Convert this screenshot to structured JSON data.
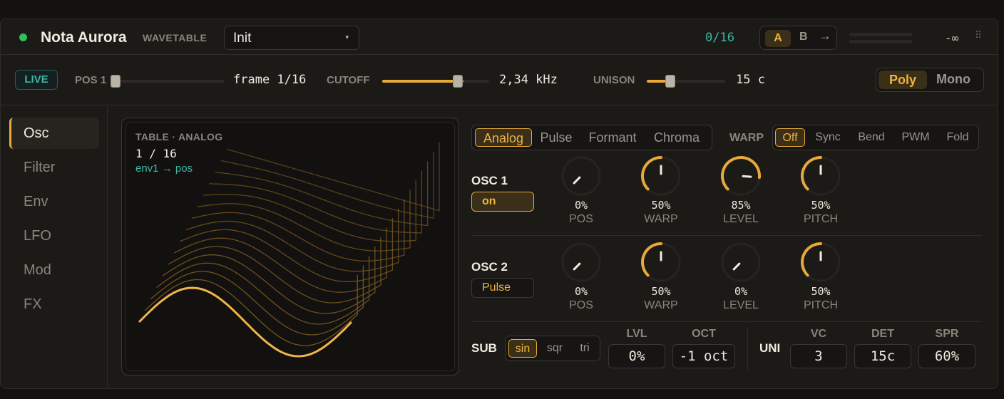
{
  "header": {
    "status_dot_color": "#2fbf5c",
    "plugin_name": "Nota Aurora",
    "engine_type": "WAVETABLE",
    "preset_name": "Init",
    "preset_arrow": "▾",
    "preset_count": "0/16",
    "ab": {
      "a": "A",
      "b": "B",
      "copy": "→"
    },
    "level_readout": "-∞",
    "drag_grip": "⠿"
  },
  "macros": {
    "live_badge": "LIVE",
    "pos": {
      "label": "POS 1",
      "value": "frame 1/16",
      "level": 0.0
    },
    "cutoff": {
      "label": "CUTOFF",
      "value": "2,34 kHz",
      "level": 0.76
    },
    "unison": {
      "label": "UNISON",
      "value": "15 c",
      "level": 0.3
    },
    "voice_mode": {
      "poly": "Poly",
      "mono": "Mono",
      "selected": "Poly"
    }
  },
  "sidebar": {
    "items": [
      {
        "label": "Osc",
        "active": true
      },
      {
        "label": "Filter",
        "active": false
      },
      {
        "label": "Env",
        "active": false
      },
      {
        "label": "LFO",
        "active": false
      },
      {
        "label": "Mod",
        "active": false
      },
      {
        "label": "FX",
        "active": false
      }
    ]
  },
  "wavetable": {
    "title": "TABLE · ANALOG",
    "frame": "1 / 16",
    "modulation": "env1 → pos",
    "accent_color": "#e8a93a"
  },
  "table_types": {
    "options": [
      "Analog",
      "Pulse",
      "Formant",
      "Chroma"
    ],
    "selected": "Analog"
  },
  "warp": {
    "label": "WARP",
    "options": [
      "Off",
      "Sync",
      "Bend",
      "PWM",
      "Fold"
    ],
    "selected": "Off"
  },
  "osc1": {
    "label": "OSC 1",
    "toggle": "on",
    "knobs": [
      {
        "name": "POS",
        "value": "0%",
        "level": 0.0
      },
      {
        "name": "WARP",
        "value": "50%",
        "level": 0.5
      },
      {
        "name": "LEVEL",
        "value": "85%",
        "level": 0.85
      },
      {
        "name": "PITCH",
        "value": "50%",
        "level": 0.5
      }
    ]
  },
  "osc2": {
    "label": "OSC 2",
    "toggle": "Pulse",
    "knobs": [
      {
        "name": "POS",
        "value": "0%",
        "level": 0.0
      },
      {
        "name": "WARP",
        "value": "50%",
        "level": 0.5
      },
      {
        "name": "LEVEL",
        "value": "0%",
        "level": 0.0
      },
      {
        "name": "PITCH",
        "value": "50%",
        "level": 0.5
      }
    ]
  },
  "sub": {
    "label": "SUB",
    "shapes": [
      "sin",
      "sqr",
      "tri"
    ],
    "selected": "sin",
    "lvl_label": "LVL",
    "lvl_value": "0%",
    "oct_label": "OCT",
    "oct_value": "-1 oct"
  },
  "unison": {
    "label": "UNI",
    "vc_label": "VC",
    "vc_value": "3",
    "det_label": "DET",
    "det_value": "15c",
    "spr_label": "SPR",
    "spr_value": "60%"
  },
  "colors": {
    "accent": "#e8a93a",
    "teal": "#3fb6a8",
    "panel": "#1b1a17"
  }
}
